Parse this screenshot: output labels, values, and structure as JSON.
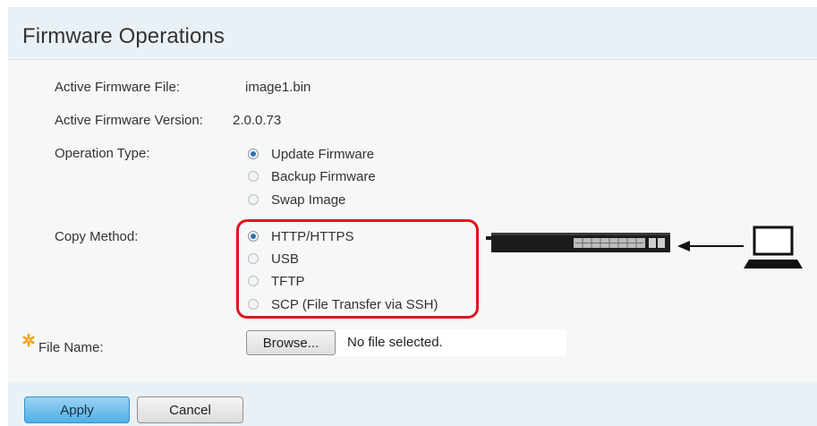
{
  "page": {
    "title": "Firmware Operations"
  },
  "fields": {
    "active_file_label": "Active Firmware File:",
    "active_file_value": "image1.bin",
    "active_version_label": "Active Firmware Version:",
    "active_version_value": "2.0.0.73",
    "operation_type_label": "Operation Type:",
    "copy_method_label": "Copy Method:",
    "file_name_label": "File Name:"
  },
  "operation_type": {
    "options": [
      "Update Firmware",
      "Backup Firmware",
      "Swap Image"
    ],
    "selected": "Update Firmware"
  },
  "copy_method": {
    "options": [
      "HTTP/HTTPS",
      "USB",
      "TFTP",
      "SCP (File Transfer via SSH)"
    ],
    "selected": "HTTP/HTTPS"
  },
  "file_input": {
    "browse_label": "Browse...",
    "status": "No file selected."
  },
  "buttons": {
    "apply": "Apply",
    "cancel": "Cancel"
  },
  "icons": {
    "required": "required-star-icon",
    "switch": "network-switch-icon",
    "arrow": "arrow-left-icon",
    "laptop": "laptop-icon"
  },
  "colors": {
    "header_bg": "#eaf1f6",
    "panel_bg": "#f6f7f7",
    "highlight_border": "#e1141c",
    "required_star": "#f0a020",
    "apply_button": "#4fb0e6"
  }
}
